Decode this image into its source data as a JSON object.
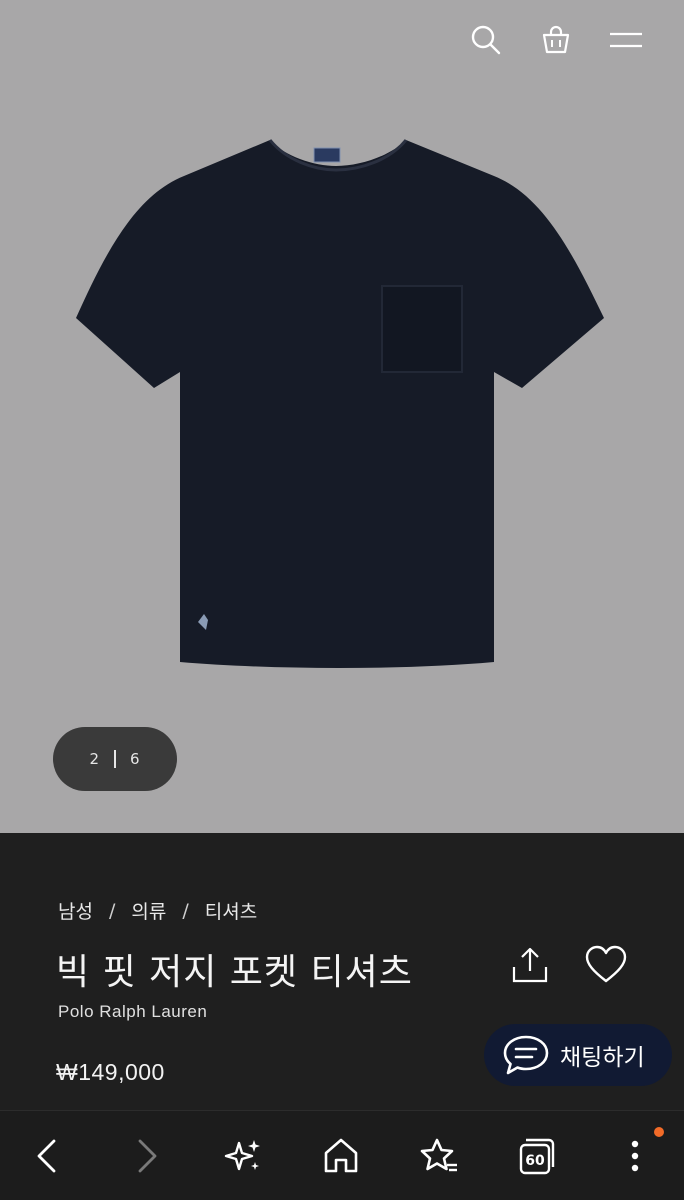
{
  "header": {
    "icons": [
      "search-icon",
      "shopping-bag-icon",
      "menu-icon"
    ]
  },
  "gallery": {
    "current": "2",
    "total": "6",
    "background": "#a8a7a8",
    "shirt_color": "#161b27",
    "neck_label": "Polo by Ralph Lauren"
  },
  "product": {
    "breadcrumb": [
      "남성",
      "의류",
      "티셔츠"
    ],
    "separator": "/",
    "title": "빅 핏 저지 포켓 티셔츠",
    "brand": "Polo Ralph Lauren",
    "price": "₩149,000"
  },
  "chat": {
    "label": "채팅하기"
  },
  "browser_bar": {
    "tab_count": "60",
    "notification_color": "#f26b28",
    "icons": [
      "back-icon",
      "forward-icon",
      "ai-sparkle-icon",
      "home-icon",
      "bookmark-star-icon",
      "tabs-icon",
      "more-menu-icon"
    ]
  }
}
